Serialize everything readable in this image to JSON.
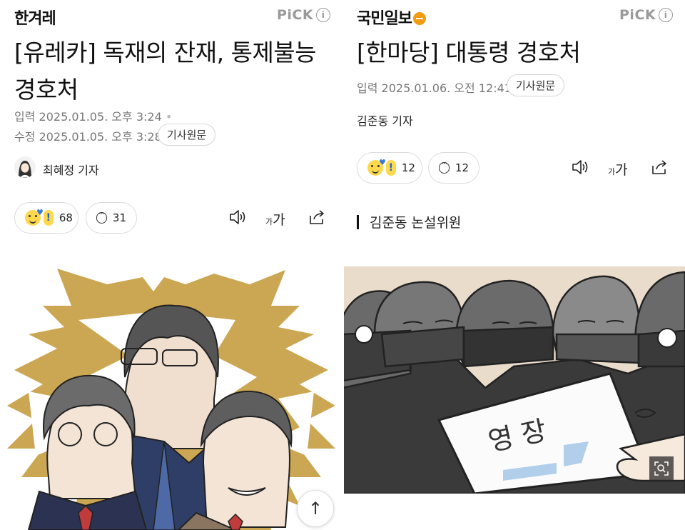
{
  "left": {
    "logo": "한겨레",
    "pick": "PiCK",
    "title_line1": "[유레카] 독재의 잔재, 통제불능",
    "title_line2": "경호처",
    "input_date": "입력 2025.01.05. 오후 3:24",
    "modified_date": "수정 2025.01.05. 오후 3:28",
    "original_btn": "기사원문",
    "reporter": "최혜정 기자",
    "reaction_count": "68",
    "comment_count": "31",
    "font_label_small": "가",
    "font_label_big": "가"
  },
  "right": {
    "logo": "국민일보",
    "pick": "PiCK",
    "title": "[한마당] 대통령 경호처",
    "input_date": "입력 2025.01.06. 오전 12:41",
    "original_btn": "기사원문",
    "reporter": "김준동 기자",
    "reaction_count": "12",
    "comment_count": "12",
    "font_label_small": "가",
    "font_label_big": "가",
    "section": "김준동 논설위원",
    "illus_sign_text": "영 장"
  },
  "icons": {
    "info": "i",
    "speaker": "speaker-icon",
    "share": "share-icon",
    "top": "↑",
    "zoom": "zoom-icon"
  },
  "colors": {
    "pick_gray": "#9a9a9a",
    "gold": "#c9a24a",
    "kukmin_orange": "#f39c12"
  }
}
